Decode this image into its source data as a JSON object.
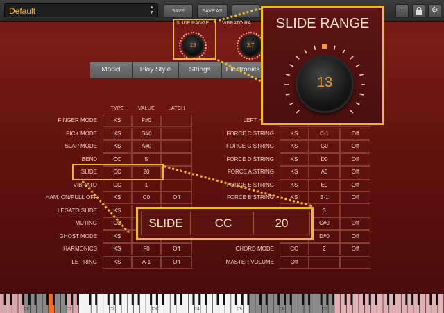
{
  "preset": {
    "name": "Default"
  },
  "toolbar": {
    "save": "SAVE",
    "save_as": "SAVE AS"
  },
  "knobs": [
    {
      "label": "SLIDE RANGE",
      "value": "13"
    },
    {
      "label": "VIBRATO RA",
      "value": "3.7"
    }
  ],
  "tabs": [
    "Model",
    "Play Style",
    "Strings",
    "Electronics"
  ],
  "left_table": {
    "headers": [
      "TYPE",
      "VALUE",
      "LATCH"
    ],
    "rows": [
      {
        "label": "FINGER MODE",
        "type": "KS",
        "value": "F#0",
        "latch": ""
      },
      {
        "label": "PICK MODE",
        "type": "KS",
        "value": "G#0",
        "latch": ""
      },
      {
        "label": "SLAP MODE",
        "type": "KS",
        "value": "A#0",
        "latch": ""
      },
      {
        "label": "BEND",
        "type": "CC",
        "value": "5",
        "latch": ""
      },
      {
        "label": "SLIDE",
        "type": "CC",
        "value": "20",
        "latch": ""
      },
      {
        "label": "VIBRATO",
        "type": "CC",
        "value": "1",
        "latch": ""
      },
      {
        "label": "HAM. ON/PULL OFF",
        "type": "KS",
        "value": "C0",
        "latch": "Off"
      },
      {
        "label": "LEGATO SLIDE",
        "type": "KS",
        "value": "",
        "latch": ""
      },
      {
        "label": "MUTING",
        "type": "CC",
        "value": "",
        "latch": ""
      },
      {
        "label": "GHOST MODE",
        "type": "KS",
        "value": "",
        "latch": ""
      },
      {
        "label": "HARMONICS",
        "type": "KS",
        "value": "F0",
        "latch": "Off"
      },
      {
        "label": "LET RING",
        "type": "KS",
        "value": "A-1",
        "latch": "Off"
      }
    ]
  },
  "right_table": {
    "rows": [
      {
        "label": "LEFT HAND",
        "type": "",
        "value": "",
        "latch": ""
      },
      {
        "label": "FORCE C STRING",
        "type": "KS",
        "value": "C-1",
        "latch": "Off"
      },
      {
        "label": "FORCE G STRING",
        "type": "KS",
        "value": "G0",
        "latch": "Off"
      },
      {
        "label": "FORCE D STRING",
        "type": "KS",
        "value": "D0",
        "latch": "Off"
      },
      {
        "label": "FORCE A STRING",
        "type": "KS",
        "value": "A0",
        "latch": "Off"
      },
      {
        "label": "FORCE E STRING",
        "type": "KS",
        "value": "E0",
        "latch": "Off"
      },
      {
        "label": "FORCE B STRING",
        "type": "KS",
        "value": "B-1",
        "latch": "Off"
      },
      {
        "label": "",
        "type": "",
        "value": "3",
        "latch": ""
      },
      {
        "label": "",
        "type": "",
        "value": "C#0",
        "latch": "Off"
      },
      {
        "label": "",
        "type": "",
        "value": "D#0",
        "latch": "Off"
      },
      {
        "label": "CHORD MODE",
        "type": "CC",
        "value": "2",
        "latch": "Off"
      },
      {
        "label": "MASTER VOLUME",
        "type": "Off",
        "value": "",
        "latch": ""
      }
    ]
  },
  "zoom_knob": {
    "title": "SLIDE RANGE",
    "value": "13"
  },
  "zoom_row": {
    "label": "SLIDE",
    "type": "CC",
    "value": "20"
  },
  "keyboard": {
    "labels": [
      "C0",
      "C1",
      "C2",
      "C3",
      "C4",
      "C5",
      "C6",
      "C7"
    ]
  },
  "colors": {
    "highlight": "#f0b828",
    "accent_orange": "#f39a38",
    "panel_red": "#6a1714"
  }
}
